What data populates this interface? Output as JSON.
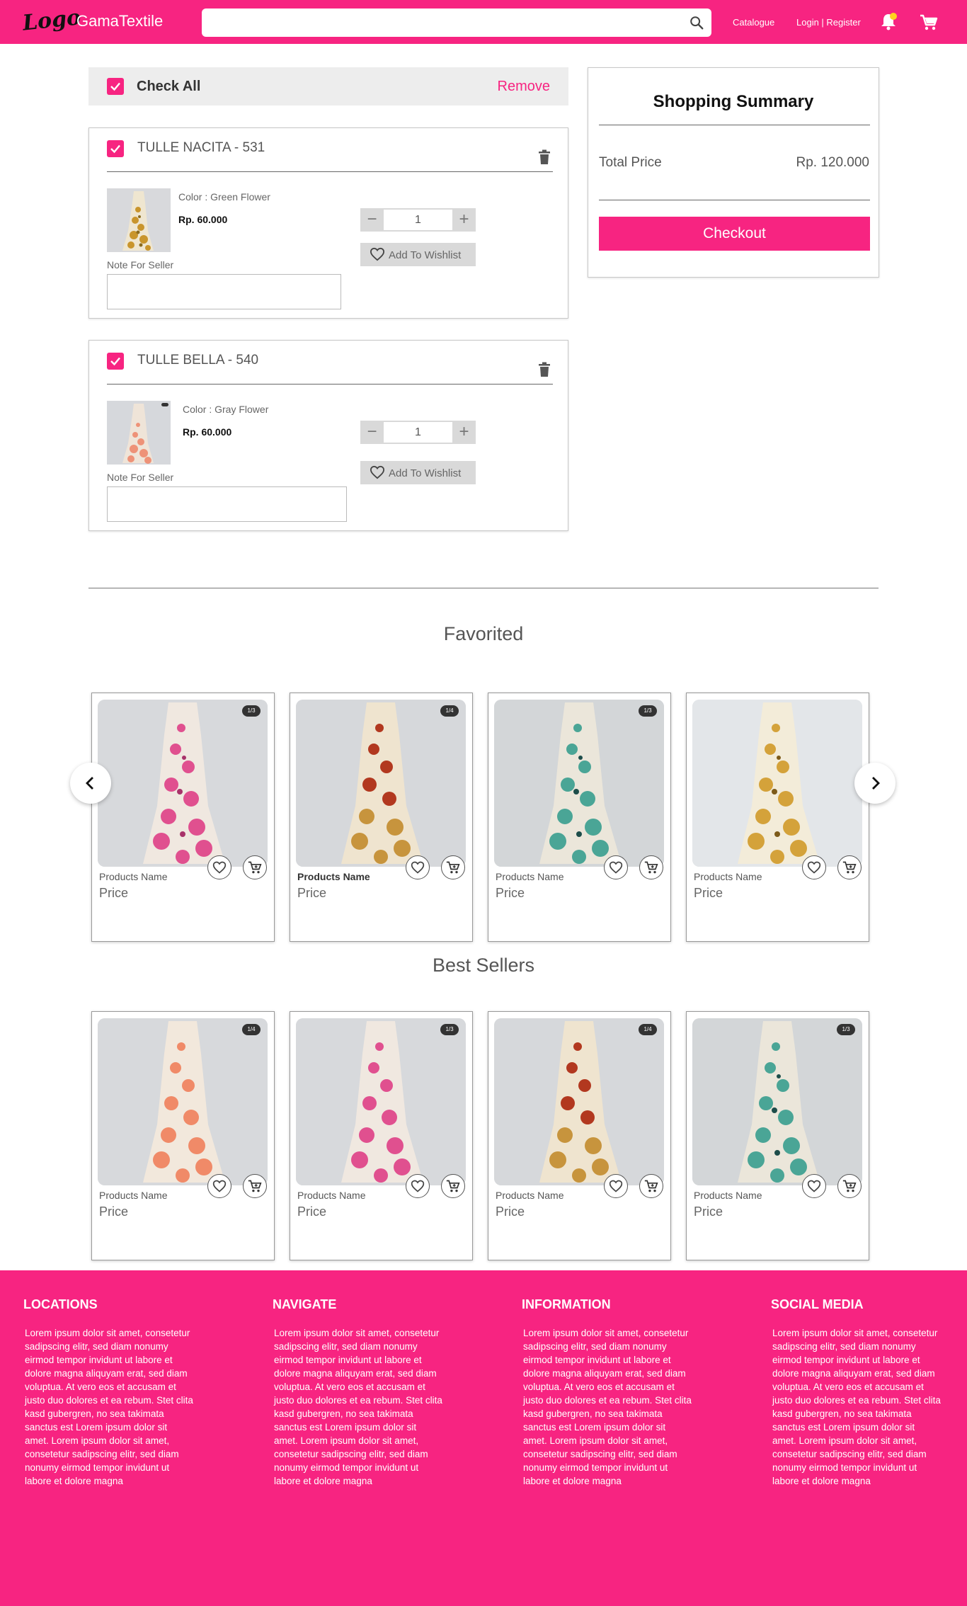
{
  "header": {
    "logo_text": "Logo",
    "brand": "GamaTextile",
    "search_placeholder": "",
    "catalogue": "Catalogue",
    "login": "Login | Register",
    "accent": "#f72481"
  },
  "cart": {
    "check_all": "Check All",
    "remove": "Remove",
    "items": [
      {
        "title": "TULLE NACITA - 531",
        "color": "Color : Green Flower",
        "price": "Rp. 60.000",
        "qty": "1",
        "wishlist": "Add To Wishlist",
        "note_label": "Note For Seller"
      },
      {
        "title": "TULLE BELLA - 540",
        "color": "Color : Gray Flower",
        "price": "Rp. 60.000",
        "qty": "1",
        "wishlist": "Add To Wishlist",
        "note_label": "Note For Seller"
      }
    ]
  },
  "summary": {
    "title": "Shopping Summary",
    "total_label": "Total Price",
    "total_value": "Rp. 120.000",
    "checkout": "Checkout"
  },
  "favorited": {
    "title": "Favorited",
    "products": [
      {
        "name": "Products Name",
        "price": "Price",
        "badge": "1/3"
      },
      {
        "name": "Products Name",
        "price": "Price",
        "badge": "1/4"
      },
      {
        "name": "Products Name",
        "price": "Price",
        "badge": "1/3"
      },
      {
        "name": "Products Name",
        "price": "Price",
        "badge": ""
      }
    ]
  },
  "best_sellers": {
    "title": "Best Sellers",
    "products": [
      {
        "name": "Products Name",
        "price": "Price",
        "badge": "1/4"
      },
      {
        "name": "Products Name",
        "price": "Price",
        "badge": "1/3"
      },
      {
        "name": "Products Name",
        "price": "Price",
        "badge": "1/4"
      },
      {
        "name": "Products Name",
        "price": "Price",
        "badge": "1/3"
      }
    ]
  },
  "footer": {
    "columns": [
      {
        "heading": "LOCATIONS",
        "text": "Lorem ipsum dolor sit amet, consetetur sadipscing elitr, sed diam nonumy eirmod tempor invidunt ut labore et dolore magna aliquyam erat, sed diam voluptua. At vero eos et accusam et justo duo dolores et ea rebum. Stet clita kasd gubergren, no sea takimata sanctus est Lorem ipsum dolor sit amet. Lorem ipsum dolor sit amet, consetetur sadipscing elitr, sed diam nonumy eirmod tempor invidunt ut labore et dolore magna"
      },
      {
        "heading": "NAVIGATE",
        "text": "Lorem ipsum dolor sit amet, consetetur sadipscing elitr, sed diam nonumy eirmod tempor invidunt ut labore et dolore magna aliquyam erat, sed diam voluptua. At vero eos et accusam et justo duo dolores et ea rebum. Stet clita kasd gubergren, no sea takimata sanctus est Lorem ipsum dolor sit amet. Lorem ipsum dolor sit amet, consetetur sadipscing elitr, sed diam nonumy eirmod tempor invidunt ut labore et dolore magna"
      },
      {
        "heading": "INFORMATION",
        "text": "Lorem ipsum dolor sit amet, consetetur sadipscing elitr, sed diam nonumy eirmod tempor invidunt ut labore et dolore magna aliquyam erat, sed diam voluptua. At vero eos et accusam et justo duo dolores et ea rebum. Stet clita kasd gubergren, no sea takimata sanctus est Lorem ipsum dolor sit amet. Lorem ipsum dolor sit amet, consetetur sadipscing elitr, sed diam nonumy eirmod tempor invidunt ut labore et dolore magna"
      },
      {
        "heading": "SOCIAL MEDIA",
        "text": "Lorem ipsum dolor sit amet, consetetur sadipscing elitr, sed diam nonumy eirmod tempor invidunt ut labore et dolore magna aliquyam erat, sed diam voluptua. At vero eos et accusam et justo duo dolores et ea rebum. Stet clita kasd gubergren, no sea takimata sanctus est Lorem ipsum dolor sit amet. Lorem ipsum dolor sit amet, consetetur sadipscing elitr, sed diam nonumy eirmod tempor invidunt ut labore et dolore magna"
      }
    ]
  }
}
